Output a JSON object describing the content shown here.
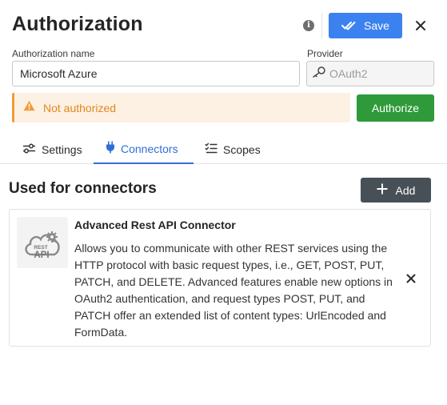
{
  "header": {
    "title": "Authorization",
    "info_icon_glyph": "i",
    "save_label": "Save"
  },
  "form": {
    "name_label": "Authorization name",
    "name_value": "Microsoft Azure",
    "provider_label": "Provider",
    "provider_value": "OAuth2"
  },
  "status": {
    "text": "Not authorized",
    "authorize_label": "Authorize"
  },
  "tabs": [
    {
      "label": "Settings",
      "icon": "sliders-icon"
    },
    {
      "label": "Connectors",
      "icon": "plug-icon",
      "active": true
    },
    {
      "label": "Scopes",
      "icon": "checklist-icon"
    }
  ],
  "connectors": {
    "title": "Used for connectors",
    "add_label": "Add",
    "items": [
      {
        "icon": "rest-api-cloud-icon",
        "logo_text_top": "REST",
        "logo_text_bottom": "API",
        "title": "Advanced Rest API Connector",
        "description": "Allows you to communicate with other REST services using the HTTP protocol with basic request types, i.e., GET, POST, PUT, PATCH, and DELETE. Advanced features enable new options in OAuth2 authentication, and request types POST, PUT, and PATCH offer an extended list of content types: UrlEncoded and FormData."
      }
    ]
  },
  "colors": {
    "primary": "#3b82f0",
    "success": "#2e9a3a",
    "warning": "#f29a38",
    "active_tab": "#2e6fd6",
    "dark_button": "#474f57"
  }
}
